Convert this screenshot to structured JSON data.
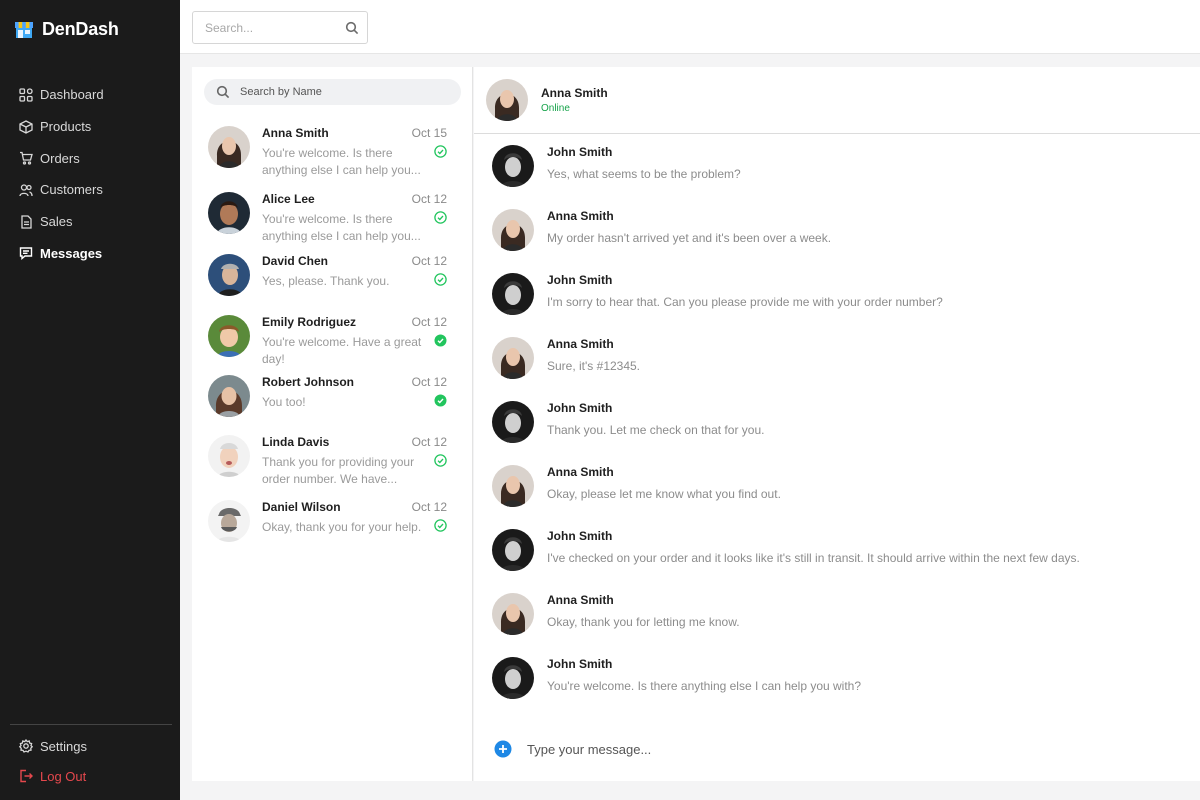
{
  "brand": {
    "name": "DenDash"
  },
  "nav": {
    "items": [
      {
        "label": "Dashboard",
        "icon": "grid-icon"
      },
      {
        "label": "Products",
        "icon": "box-icon"
      },
      {
        "label": "Orders",
        "icon": "cart-icon"
      },
      {
        "label": "Customers",
        "icon": "users-icon"
      },
      {
        "label": "Sales",
        "icon": "document-icon"
      },
      {
        "label": "Messages",
        "icon": "message-icon",
        "active": true
      }
    ],
    "settings_label": "Settings",
    "logout_label": "Log Out"
  },
  "topbar": {
    "search_placeholder": "Search..."
  },
  "contacts": {
    "search_placeholder": "Search by Name",
    "items": [
      {
        "name": "Anna Smith",
        "date": "Oct 15",
        "preview": "You're welcome. Is there anything else I can help you...",
        "read": true
      },
      {
        "name": "Alice Lee",
        "date": "Oct 12",
        "preview": "You're welcome. Is there anything else I can help you...",
        "read": true
      },
      {
        "name": "David Chen",
        "date": "Oct 12",
        "preview": "Yes, please. Thank you.",
        "read": true
      },
      {
        "name": "Emily Rodriguez",
        "date": "Oct 12",
        "preview": "You're welcome. Have a great day!",
        "read": false
      },
      {
        "name": "Robert Johnson",
        "date": "Oct 12",
        "preview": "You too!",
        "read": false
      },
      {
        "name": "Linda Davis",
        "date": "Oct 12",
        "preview": "Thank you for providing your order number. We have...",
        "read": true
      },
      {
        "name": "Daniel Wilson",
        "date": "Oct 12",
        "preview": "Okay, thank you for your help.",
        "read": true
      }
    ]
  },
  "chat": {
    "header": {
      "name": "Anna Smith",
      "status": "Online"
    },
    "messages": [
      {
        "author": "John Smith",
        "text": "Yes, what seems to be the problem?"
      },
      {
        "author": "Anna Smith",
        "text": "My order hasn't arrived yet and it's been over a week."
      },
      {
        "author": "John Smith",
        "text": "I'm sorry to hear that. Can you please provide me with your order number?"
      },
      {
        "author": "Anna Smith",
        "text": "Sure, it's #12345."
      },
      {
        "author": "John Smith",
        "text": "Thank you. Let me check on that for you."
      },
      {
        "author": "Anna Smith",
        "text": "Okay, please let me know what you find out."
      },
      {
        "author": "John Smith",
        "text": "I've checked on your order and it looks like it's still in transit. It should arrive within the next few days."
      },
      {
        "author": "Anna Smith",
        "text": "Okay, thank you for letting me know."
      },
      {
        "author": "John Smith",
        "text": "You're welcome. Is there anything else I can help you with?"
      }
    ],
    "composer_placeholder": "Type your message..."
  },
  "colors": {
    "sidebar_bg": "#1b1b1b",
    "online_green": "#16a34a",
    "read_check_green": "#22c55e",
    "logout_red": "#e5484d",
    "composer_plus_blue": "#1e88e5"
  }
}
